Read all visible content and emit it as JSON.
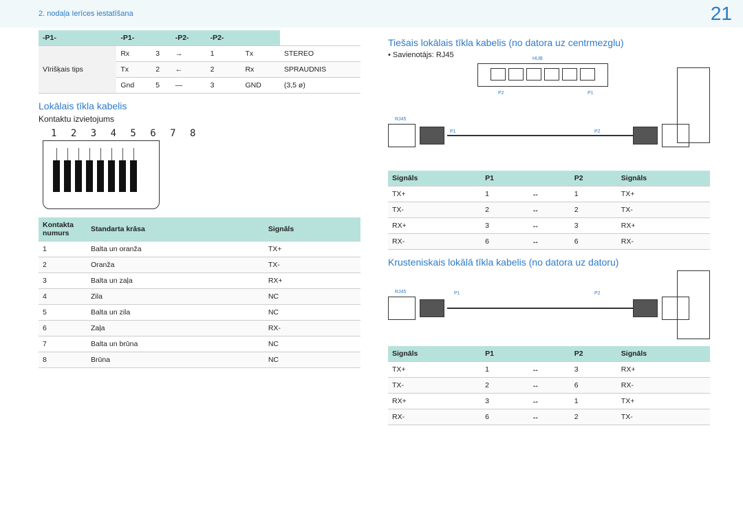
{
  "header": {
    "chapter": "2. nodaļa Ierīces iestatīšana",
    "page": "21"
  },
  "left": {
    "table1_head": [
      "-P1-",
      "-P1-",
      "",
      "-P2-",
      "-P2-",
      ""
    ],
    "table1_rowhead": "Vīrišķais tips",
    "table1_rows": [
      [
        "Rx",
        "3",
        "→",
        "1",
        "Tx",
        "STEREO"
      ],
      [
        "Tx",
        "2",
        "←",
        "2",
        "Rx",
        "SPRAUDNIS"
      ],
      [
        "Gnd",
        "5",
        "—",
        "3",
        "GND",
        "(3,5 ø)"
      ]
    ],
    "h_lan": "Lokālais tīkla kabelis",
    "sub_pins": "Kontaktu izvietojums",
    "pins": "1 2 3 4 5 6 7 8",
    "table2_head": [
      "Kontakta numurs",
      "Standarta krāsa",
      "Signāls"
    ],
    "table2_rows": [
      [
        "1",
        "Balta un oranža",
        "TX+"
      ],
      [
        "2",
        "Oranža",
        "TX-"
      ],
      [
        "3",
        "Balta un zaļa",
        "RX+"
      ],
      [
        "4",
        "Zila",
        "NC"
      ],
      [
        "5",
        "Balta un zila",
        "NC"
      ],
      [
        "6",
        "Zaļa",
        "RX-"
      ],
      [
        "7",
        "Balta un brūna",
        "NC"
      ],
      [
        "8",
        "Brūna",
        "NC"
      ]
    ]
  },
  "right": {
    "h_direct": "Tiešais lokālais tīkla kabelis (no datora uz centrmezglu)",
    "bullet_connector": "•  Savienotājs: RJ45",
    "diag_labels": {
      "hub": "HUB",
      "rj45": "RJ45",
      "p1": "P1",
      "p2": "P2"
    },
    "table3_head": [
      "Signāls",
      "P1",
      "",
      "P2",
      "Signāls"
    ],
    "table3_rows": [
      [
        "TX+",
        "1",
        "↔",
        "1",
        "TX+"
      ],
      [
        "TX-",
        "2",
        "↔",
        "2",
        "TX-"
      ],
      [
        "RX+",
        "3",
        "↔",
        "3",
        "RX+"
      ],
      [
        "RX-",
        "6",
        "↔",
        "6",
        "RX-"
      ]
    ],
    "h_cross": "Krusteniskais lokālā tīkla kabelis (no datora uz datoru)",
    "table4_head": [
      "Signāls",
      "P1",
      "",
      "P2",
      "Signāls"
    ],
    "table4_rows": [
      [
        "TX+",
        "1",
        "↔",
        "3",
        "RX+"
      ],
      [
        "TX-",
        "2",
        "↔",
        "6",
        "RX-"
      ],
      [
        "RX+",
        "3",
        "↔",
        "1",
        "TX+"
      ],
      [
        "RX-",
        "6",
        "↔",
        "2",
        "TX-"
      ]
    ]
  }
}
